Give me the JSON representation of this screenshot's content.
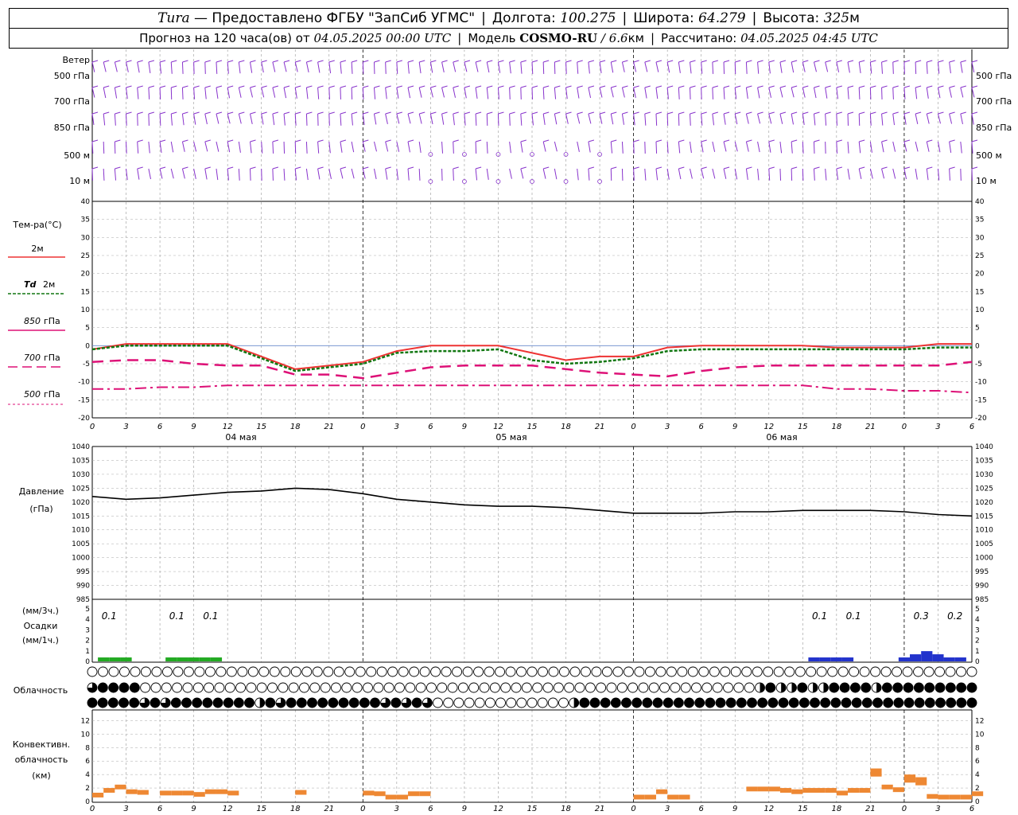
{
  "header": {
    "station": "Tura",
    "provider": "— Предоставлено ФГБУ \"ЗапСиб УГМС\"",
    "lon_label": "Долгота:",
    "lon": "100.275",
    "lat_label": "Широта:",
    "lat": "64.279",
    "alt_label": "Высота:",
    "alt": "325",
    "alt_unit": "м",
    "forecast_prefix": "Прогноз на 120 часа(ов) от",
    "forecast_start": "04.05.2025 00:00 UTC",
    "model_label": "Модель",
    "model": "COSMO-RU",
    "resolution": "/ 6.6",
    "resolution_unit": "км",
    "computed_label": "Рассчитано:",
    "computed": "04.05.2025 04:45 UTC"
  },
  "labels": {
    "wind": "Ветер",
    "wind_levels": [
      "500 гПа",
      "700 гПа",
      "850 гПа",
      "500 м",
      "10 м"
    ],
    "temp_title": "Тем-ра(°C)",
    "temp_2m": "2м",
    "td_label": "Td",
    "td_2m": "2м",
    "t850_a": "850",
    "t850_b": "гПа",
    "t700_a": "700",
    "t700_b": "гПа",
    "t500_a": "500",
    "t500_b": "гПа",
    "pressure_a": "Давление",
    "pressure_b": "(гПа)",
    "precip_a": "(мм/3ч.)",
    "precip_b": "Осадки",
    "precip_c": "(мм/1ч.)",
    "cloud": "Облачность",
    "conv_a": "Конвективн.",
    "conv_b": "облачность",
    "conv_c": "(км)",
    "days": [
      "04 мая",
      "05 мая",
      "06 мая"
    ]
  },
  "colors": {
    "t2m": "#ee3333",
    "td2m": "#117711",
    "t850": "#dd1177",
    "t700": "#dd1177",
    "t500": "#dd1177",
    "pressure": "#000000",
    "precip_green": "#22aa22",
    "precip_blue": "#2233cc",
    "convective": "#ee8833",
    "wind": "#8833cc"
  },
  "chart_data": [
    {
      "type": "line",
      "name": "temperature",
      "ylim": [
        -20,
        40
      ],
      "y_ticks": [
        -20,
        -15,
        -10,
        -5,
        0,
        5,
        10,
        15,
        20,
        25,
        30,
        35,
        40
      ],
      "x_ticks": [
        "0",
        "3",
        "6",
        "9",
        "12",
        "15",
        "18",
        "21",
        "0",
        "3",
        "6",
        "9",
        "12",
        "15",
        "18",
        "21",
        "0",
        "3",
        "6",
        "9",
        "12",
        "15",
        "18",
        "21",
        "0",
        "3",
        "6"
      ],
      "x_hours": [
        0,
        3,
        6,
        9,
        12,
        15,
        18,
        21,
        24,
        27,
        30,
        33,
        36,
        39,
        42,
        45,
        48,
        51,
        54,
        57,
        60,
        63,
        66,
        69,
        72,
        75,
        78
      ],
      "series": [
        {
          "key": "t2m",
          "values": [
            -1,
            0.5,
            0.5,
            0.5,
            0.5,
            -3,
            -6.5,
            -5.5,
            -4.5,
            -1.5,
            0,
            0,
            0,
            -2,
            -4,
            -3,
            -3,
            -0.5,
            0,
            0,
            0,
            0,
            -0.5,
            -0.5,
            -0.5,
            0.5,
            0.5
          ]
        },
        {
          "key": "td2m",
          "values": [
            -1,
            0,
            0,
            0,
            0,
            -3.5,
            -7,
            -6,
            -5,
            -2,
            -1.5,
            -1.5,
            -1,
            -4,
            -5,
            -4.5,
            -3.5,
            -1.5,
            -1,
            -1,
            -1,
            -1,
            -1,
            -1,
            -1,
            -0.5,
            -0.5
          ]
        },
        {
          "key": "t850",
          "values": [
            -4.5,
            -4,
            -4,
            -5,
            -5.5,
            -5.5,
            -8,
            -8,
            -9,
            -7.5,
            -6,
            -5.5,
            -5.5,
            -5.5,
            -6.5,
            -7.5,
            -8,
            -8.5,
            -7,
            -6,
            -5.5,
            -5.5,
            -5.5,
            -5.5,
            -5.5,
            -5.5,
            -4.5
          ]
        },
        {
          "key": "t700",
          "values": [
            -4.5,
            -4,
            -4,
            -5,
            -5.5,
            -5.5,
            -8,
            -8,
            -9,
            -7.5,
            -6,
            -5.5,
            -5.5,
            -5.5,
            -6.5,
            -7.5,
            -8,
            -8.5,
            -7,
            -6,
            -5.5,
            -5.5,
            -5.5,
            -5.5,
            -5.5,
            -5.5,
            -4.5
          ]
        },
        {
          "key": "t500",
          "values": [
            -12,
            -12,
            -11.5,
            -11.5,
            -11,
            -11,
            -11,
            -11,
            -11,
            -11,
            -11,
            -11,
            -11,
            -11,
            -11,
            -11,
            -11,
            -11,
            -11,
            -11,
            -11,
            -11,
            -12,
            -12,
            -12.5,
            -12.5,
            -13
          ]
        }
      ]
    },
    {
      "type": "line",
      "name": "pressure",
      "ylim": [
        985,
        1040
      ],
      "y_ticks": [
        985,
        990,
        995,
        1000,
        1005,
        1010,
        1015,
        1020,
        1025,
        1030,
        1035,
        1040
      ],
      "x_hours": [
        0,
        3,
        6,
        9,
        12,
        15,
        18,
        21,
        24,
        27,
        30,
        33,
        36,
        39,
        42,
        45,
        48,
        51,
        54,
        57,
        60,
        63,
        66,
        69,
        72,
        75,
        78
      ],
      "values": [
        1022,
        1021,
        1021.5,
        1022.5,
        1023.5,
        1024,
        1025,
        1024.5,
        1023,
        1021,
        1020,
        1019,
        1018.5,
        1018.5,
        1018,
        1017,
        1016,
        1016,
        1016,
        1016.5,
        1016.5,
        1017,
        1017,
        1017,
        1016.5,
        1015.5,
        1015
      ]
    },
    {
      "type": "bar",
      "name": "precipitation",
      "ylim": [
        0,
        5
      ],
      "y_ticks": [
        0,
        1,
        2,
        3,
        4,
        5
      ],
      "labels": [
        {
          "hour": 1.5,
          "text": "0.1"
        },
        {
          "hour": 7.5,
          "text": "0.1"
        },
        {
          "hour": 10.5,
          "text": "0.1"
        },
        {
          "hour": 64.5,
          "text": "0.1"
        },
        {
          "hour": 67.5,
          "text": "0.1"
        },
        {
          "hour": 73.5,
          "text": "0.3"
        },
        {
          "hour": 76.5,
          "text": "0.2"
        }
      ],
      "bars_green": [
        [
          1,
          0.1
        ],
        [
          2,
          0.1
        ],
        [
          3,
          0.1
        ],
        [
          7,
          0.1
        ],
        [
          8,
          0.1
        ],
        [
          9,
          0.1
        ],
        [
          10,
          0.1
        ],
        [
          11,
          0.1
        ]
      ],
      "bars_blue": [
        [
          64,
          0.1
        ],
        [
          65,
          0.1
        ],
        [
          66,
          0.1
        ],
        [
          67,
          0.1
        ],
        [
          72,
          0.1
        ],
        [
          73,
          0.2
        ],
        [
          74,
          0.3
        ],
        [
          75,
          0.2
        ],
        [
          76,
          0.1
        ],
        [
          77,
          0.1
        ]
      ]
    },
    {
      "type": "bar",
      "name": "convective_cloud",
      "ylim": [
        0,
        13
      ],
      "y_ticks": [
        0,
        2,
        4,
        6,
        8,
        10,
        12
      ],
      "bars": [
        [
          0,
          1.3
        ],
        [
          1,
          2
        ],
        [
          2,
          2.5
        ],
        [
          3,
          1.8
        ],
        [
          4,
          1.7
        ],
        [
          6,
          1.6
        ],
        [
          7,
          1.6
        ],
        [
          8,
          1.6
        ],
        [
          9,
          1.4
        ],
        [
          10,
          1.8
        ],
        [
          11,
          1.8
        ],
        [
          12,
          1.6
        ],
        [
          18,
          1.7
        ],
        [
          24,
          1.6
        ],
        [
          25,
          1.5
        ],
        [
          26,
          1
        ],
        [
          27,
          1
        ],
        [
          28,
          1.5
        ],
        [
          29,
          1.5
        ],
        [
          48,
          1
        ],
        [
          49,
          1
        ],
        [
          50,
          1.8
        ],
        [
          51,
          1
        ],
        [
          52,
          1
        ],
        [
          58,
          2.2
        ],
        [
          59,
          2.2
        ],
        [
          60,
          2.2
        ],
        [
          61,
          2
        ],
        [
          62,
          1.8
        ],
        [
          63,
          2
        ],
        [
          64,
          2
        ],
        [
          65,
          2
        ],
        [
          66,
          1.6
        ],
        [
          67,
          2
        ],
        [
          68,
          2
        ],
        [
          69,
          4.9
        ],
        [
          70,
          2.5
        ],
        [
          71,
          2.1
        ],
        [
          72,
          4
        ],
        [
          73,
          3.6
        ],
        [
          74,
          1.1
        ],
        [
          75,
          1
        ],
        [
          76,
          1
        ],
        [
          77,
          1
        ],
        [
          78,
          1.5
        ]
      ]
    }
  ],
  "cloud_rows": [
    "OOOOOOOOOOOOOOOOOOOOOOOOOOOOOOOOOOOOOOOOOOOOOOOOOOOOOOOOOOOOOOOOOOOOOOOOOOOOOOOOOOO",
    "qFFFFOOOOOOOOOOOOOOOOOOOOOOOOOOOOOOOOOOOOOOOOOOOOOOOOOOOOOOOOOOhFhhFhhFFFFhFFFFFFFFF",
    "FFFFFqFqFFFFFFFFhFqFFFFFFFFFqFqFqOOOOOOOOOOOOOhFFFFFFFFFFFFFFFFFFFFFFFFFFFFFFFFFFFFFF"
  ]
}
